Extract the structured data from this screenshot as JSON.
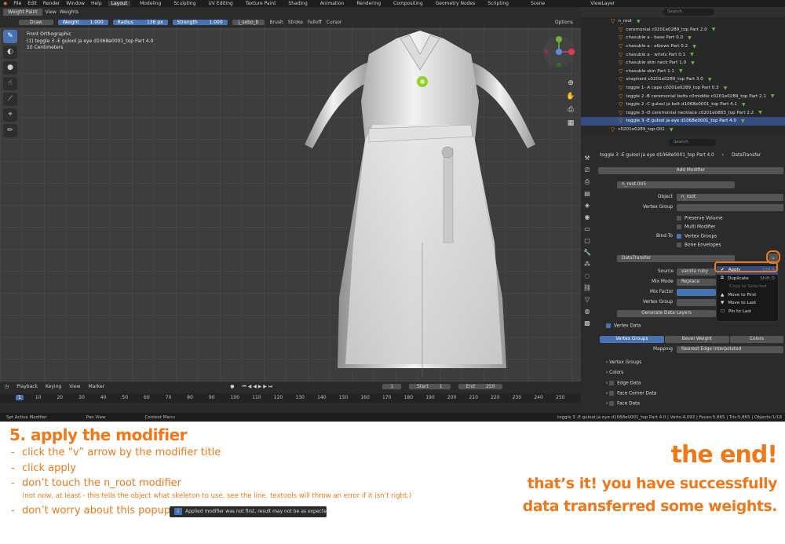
{
  "topbar": {
    "menus": [
      "File",
      "Edit",
      "Render",
      "Window",
      "Help"
    ],
    "workspaces": [
      "Layout",
      "Modeling",
      "Sculpting",
      "UV Editing",
      "Texture Paint",
      "Shading",
      "Animation",
      "Rendering",
      "Compositing",
      "Geometry Nodes",
      "Scripting"
    ],
    "active_workspace": "Layout",
    "scene": "Scene",
    "view_layer": "ViewLayer"
  },
  "toolheader": {
    "mode": "Weight Paint",
    "view": "View",
    "weights": "Weights",
    "brush_name": "Draw",
    "weight_label": "Weight",
    "weight_value": "1.000",
    "radius_label": "Radius",
    "radius_value": "136 px",
    "strength_label": "Strength",
    "strength_value": "1.000",
    "vertex_group": "j_sebo_b",
    "brush": "Brush",
    "stroke": "Stroke",
    "falloff": "Falloff",
    "cursor": "Cursor",
    "options": "Options"
  },
  "viewport": {
    "info": [
      "Front Orthographic",
      "(1) toggle 3 -E gulool ja eye d1068e0001_top Part 4.0",
      "10 Centimeters"
    ]
  },
  "timeline": {
    "menus": [
      "Playback",
      "Keying",
      "View",
      "Marker"
    ],
    "current_frame": "1",
    "start_label": "Start",
    "start": "1",
    "end_label": "End",
    "end": "250",
    "ticks": [
      "1",
      "10",
      "20",
      "30",
      "40",
      "50",
      "60",
      "70",
      "80",
      "90",
      "100",
      "110",
      "120",
      "130",
      "140",
      "150",
      "160",
      "170",
      "180",
      "190",
      "200",
      "210",
      "220",
      "230",
      "240",
      "250"
    ]
  },
  "statusbar": {
    "left": "Set Active Modifier",
    "middle": "Pan View",
    "context": "Context Menu",
    "right": "toggle 3 -E gulool ja eye d1068e0001_top Part 4.0 | Verts:4,093 | Faces:5,865 | Tris:5,865 | Objects:1/18"
  },
  "outliner": {
    "search_placeholder": "Search",
    "items": [
      "n_root",
      "ceremonial c0201e0289_top Part 2.0",
      "chasuble a - base Part 0.0",
      "chasuble a - elbows Part 0.2",
      "chasuble a - wrists Part 0.1",
      "chasuble skin neck Part 1.0",
      "chasuble skin Part 1.1",
      "shepherd c0201e0289_top Part 3.0",
      "toggle 1- A cape c0201e0289_top Part 0.3",
      "toggle 2 -B ceremonial belts c0middle c0201e0289_top Part 2.1",
      "toggle 2 -C gulool ja belt d1068e0001_top Part 4.1",
      "toggle 3 -D ceremonial necklace c0201e0883_top Part 2.2",
      "toggle 3 -E gulool ja eye d1068e0001_top Part 4.0",
      "c0201e0289_top.001"
    ],
    "selected_index": 12
  },
  "properties": {
    "search_placeholder": "Search",
    "object_path": "toggle 3 -E gulool ja eye d1068e0001_top Part 4.0",
    "modifier_tab": "DataTransfer",
    "add_modifier": "Add Modifier",
    "mod1_name": "n_root.005",
    "object_label": "Object",
    "object_value": "n_root",
    "vertex_group_label": "Vertex Group",
    "preserve_volume": "Preserve Volume",
    "multi_modifier": "Multi Modifier",
    "bind_to_label": "Bind To",
    "vertex_groups_cb": "Vertex Groups",
    "bone_envelopes": "Bone Envelopes",
    "mod2_name": "DataTransfer",
    "source_label": "Source",
    "source_value": "vanilla ruby",
    "mix_mode_label": "Mix Mode",
    "mix_mode_value": "Replace",
    "mix_factor_label": "Mix Factor",
    "vertex_group2_label": "Vertex Group",
    "generate_label": "Generate Data Layers",
    "vertex_data": "Vertex Data",
    "tab_vertex_groups": "Vertex Groups",
    "tab_bevel_weight": "Bevel Weight",
    "tab_colors": "Colors",
    "mapping_label": "Mapping",
    "mapping_value": "Nearest Edge Interpolated",
    "sub_vertex_groups": "Vertex Groups",
    "sub_colors": "Colors",
    "edge_data": "Edge Data",
    "face_corner_data": "Face Corner Data",
    "face_data": "Face Data"
  },
  "dropdown": {
    "items": [
      {
        "label": "Apply",
        "shortcut": "Ctrl A"
      },
      {
        "label": "Duplicate",
        "shortcut": "Shift D"
      },
      {
        "label": "Copy to Selected",
        "shortcut": ""
      },
      {
        "label": "Move to First",
        "shortcut": ""
      },
      {
        "label": "Move to Last",
        "shortcut": ""
      },
      {
        "label": "Pin to Last",
        "shortcut": ""
      }
    ]
  },
  "annotation": {
    "title": "5. apply the modifier",
    "line1": "click the “v” arrow by the modifier title",
    "line2": "click apply",
    "line3": "don’t touch the n_root modifier",
    "note": "(not now, at least - this tells the object what skeleton to use, see the line. textools will throw an error if it isn’t right.)",
    "line4": "don’t worry about this popup",
    "popup": "Applied modifier was not first, result may not be as expected",
    "end_title": "the end!",
    "end_line1": "that’s it! you have successfully",
    "end_line2": "data transferred some weights."
  },
  "colors": {
    "accent": "#f07818",
    "blender_blue": "#4772b3"
  }
}
